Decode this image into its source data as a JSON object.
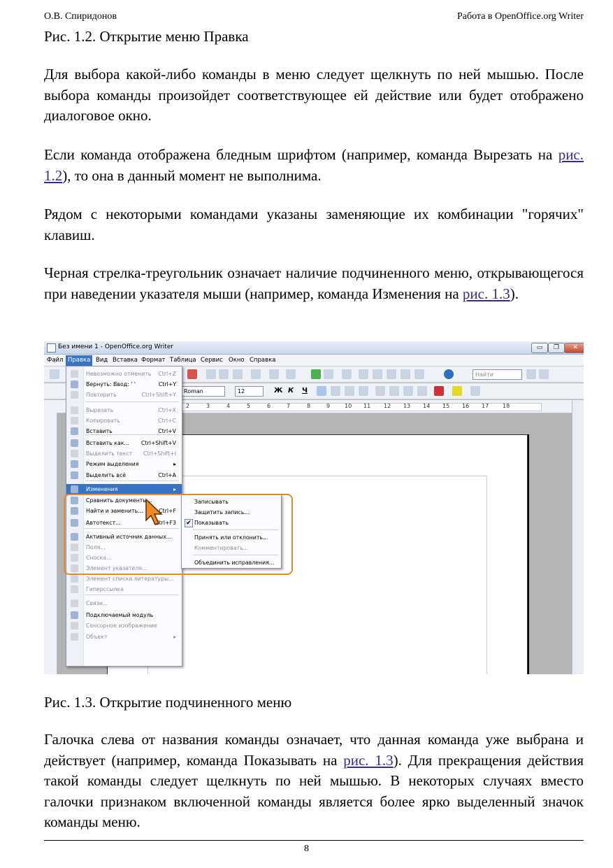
{
  "header": {
    "author": "О.В. Спиридонов",
    "title": "Работа в OpenOffice.org Writer"
  },
  "caption1": "Рис. 1.2.  Открытие меню Правка",
  "paragraphs": {
    "p1": "Для выбора какой-либо команды в меню следует щелкнуть по ней мышью. После выбора команды произойдет соответствующее ей действие или будет отображено диалоговое окно.",
    "p2_a": "Если команда отображена бледным шрифтом (например, команда Вырезать на ",
    "p2_link": "рис. 1.2",
    "p2_b": "), то она в данный момент не выполнима.",
    "p3": "Рядом с некоторыми командами указаны заменяющие их комбинации \"горячих\" клавиш.",
    "p4_a": "Черная стрелка-треугольник означает наличие подчиненного меню, открывающегося при наведении указателя мыши (например, команда Изменения на ",
    "p4_link": "рис. 1.3",
    "p4_b": ").",
    "p5_a": "Галочка слева от названия команды означает, что данная команда уже выбрана и действует (например, команда Показывать на ",
    "p5_link": "рис. 1.3",
    "p5_b": "). Для прекращения действия такой команды следует щелкнуть по ней мышью. В некоторых случаях вместо галочки признаком включенной команды является более ярко выделенный значок команды меню."
  },
  "caption2": "Рис. 1.3.  Открытие подчиненного меню",
  "page_number": "8",
  "screenshot": {
    "window_title": "Без имени 1 - OpenOffice.org Writer",
    "window_buttons": {
      "minimize": "▭",
      "maximize": "❐",
      "close": "✕"
    },
    "menubar": [
      "Файл",
      "Правка",
      "Вид",
      "Вставка",
      "Формат",
      "Таблица",
      "Сервис",
      "Окно",
      "Справка"
    ],
    "toolbar": {
      "find_placeholder": "Найти",
      "font_name": "Roman",
      "font_size": "12",
      "bold": "Ж",
      "italic": "К",
      "underline": "Ч"
    },
    "ruler_numbers": [
      "2",
      "3",
      "4",
      "5",
      "6",
      "7",
      "8",
      "9",
      "10",
      "11",
      "12",
      "13",
      "14",
      "15",
      "16",
      "17",
      "18"
    ],
    "edit_menu": [
      {
        "label": "Невозможно отменить",
        "shortcut": "Ctrl+Z",
        "disabled": true
      },
      {
        "label": "Вернуть: Ввод: ' '",
        "shortcut": "Ctrl+Y",
        "disabled": false
      },
      {
        "label": "Повторить",
        "shortcut": "Ctrl+Shift+Y",
        "disabled": true
      },
      {
        "label": "Вырезать",
        "shortcut": "Ctrl+X",
        "disabled": true
      },
      {
        "label": "Копировать",
        "shortcut": "Ctrl+C",
        "disabled": true
      },
      {
        "label": "Вставить",
        "shortcut": "Ctrl+V",
        "disabled": false
      },
      {
        "label": "Вставить как...",
        "shortcut": "Ctrl+Shift+V",
        "disabled": false
      },
      {
        "label": "Выделить текст",
        "shortcut": "Ctrl+Shift+I",
        "disabled": true
      },
      {
        "label": "Режим выделения",
        "shortcut": "▸",
        "disabled": false
      },
      {
        "label": "Выделить всё",
        "shortcut": "Ctrl+A",
        "disabled": false
      },
      {
        "label": "Изменения",
        "shortcut": "▸",
        "disabled": false
      },
      {
        "label": "Сравнить документы...",
        "shortcut": "",
        "disabled": false
      },
      {
        "label": "Найти и заменить...",
        "shortcut": "Ctrl+F",
        "disabled": false
      },
      {
        "label": "Автотекст...",
        "shortcut": "Ctrl+F3",
        "disabled": false
      },
      {
        "label": "Активный источник данных...",
        "shortcut": "",
        "disabled": false
      },
      {
        "label": "Поля...",
        "shortcut": "",
        "disabled": true
      },
      {
        "label": "Сноска...",
        "shortcut": "",
        "disabled": true
      },
      {
        "label": "Элемент указателя...",
        "shortcut": "",
        "disabled": true
      },
      {
        "label": "Элемент списка литературы...",
        "shortcut": "",
        "disabled": true
      },
      {
        "label": "Гиперссылка",
        "shortcut": "",
        "disabled": true
      },
      {
        "label": "Связи...",
        "shortcut": "",
        "disabled": true
      },
      {
        "label": "Подключаемый модуль",
        "shortcut": "",
        "disabled": false
      },
      {
        "label": "Сенсорное изображение",
        "shortcut": "",
        "disabled": true
      },
      {
        "label": "Объект",
        "shortcut": "▸",
        "disabled": true
      }
    ],
    "changes_submenu": [
      {
        "label": "Записывать",
        "checked": false,
        "disabled": false
      },
      {
        "label": "Защитить запись...",
        "checked": false,
        "disabled": false
      },
      {
        "label": "Показывать",
        "checked": true,
        "disabled": false
      },
      {
        "label": "Принять или отклонить...",
        "checked": false,
        "disabled": false
      },
      {
        "label": "Комментировать...",
        "checked": false,
        "disabled": true
      },
      {
        "label": "Объединить исправления...",
        "checked": false,
        "disabled": false
      }
    ],
    "colors": {
      "highlight": "#3b73c4",
      "callout": "#e08a2e"
    }
  }
}
